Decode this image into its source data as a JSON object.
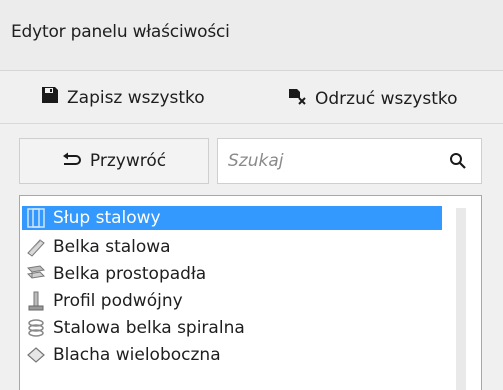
{
  "window": {
    "title": "Edytor panelu właściwości"
  },
  "toolbar": {
    "save_label": "Zapisz wszystko",
    "discard_label": "Odrzuć wszystko"
  },
  "controls": {
    "restore_label": "Przywróć",
    "search_placeholder": "Szukaj"
  },
  "list": {
    "selected_index": 0,
    "items": [
      {
        "label": "Słup stalowy",
        "icon": "steel-column-icon"
      },
      {
        "label": "Belka stalowa",
        "icon": "steel-beam-icon"
      },
      {
        "label": "Belka prostopadła",
        "icon": "orthogonal-beam-icon"
      },
      {
        "label": "Profil podwójny",
        "icon": "twin-profile-icon"
      },
      {
        "label": "Stalowa belka spiralna",
        "icon": "spiral-beam-icon"
      },
      {
        "label": "Blacha wieloboczna",
        "icon": "contour-plate-icon"
      }
    ]
  },
  "colors": {
    "selection": "#3399ff",
    "background": "#f0f0f0"
  }
}
